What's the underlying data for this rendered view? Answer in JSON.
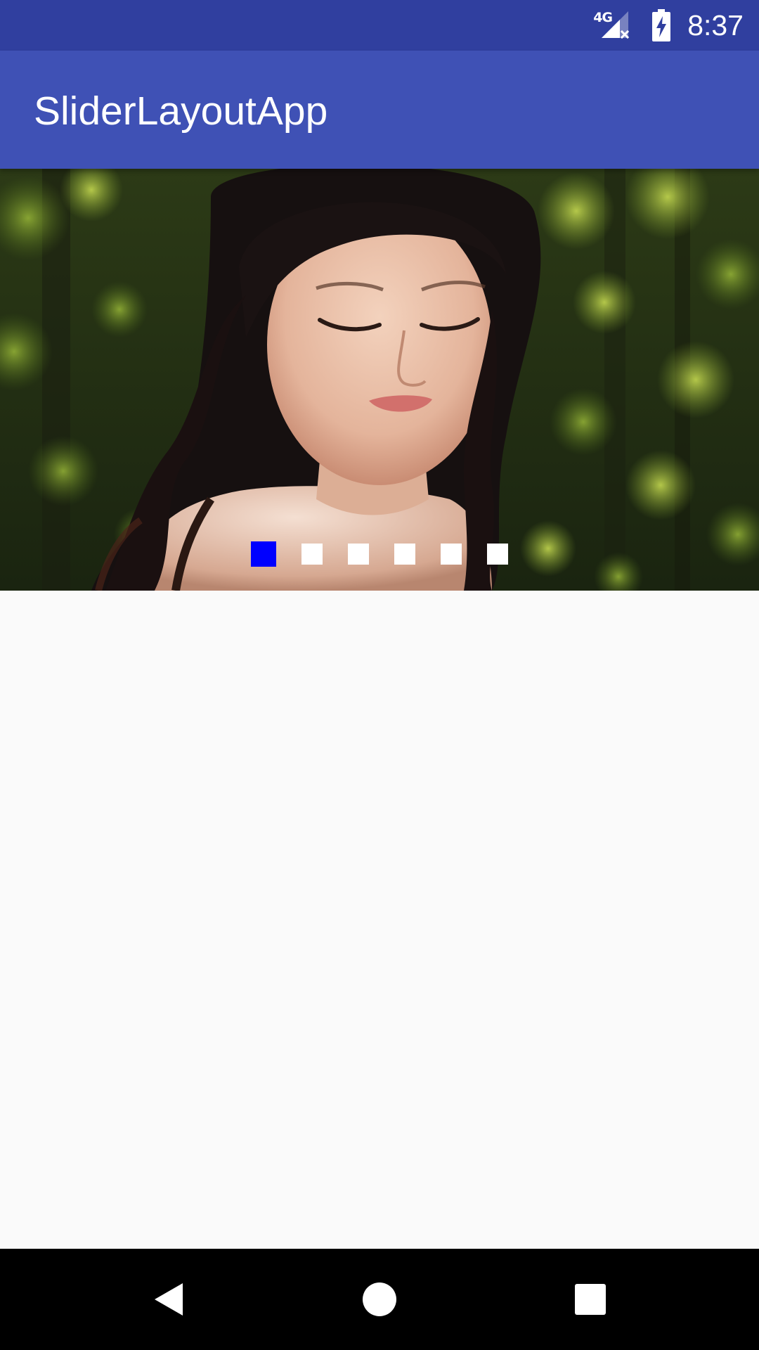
{
  "status_bar": {
    "network_type": "4G",
    "time": "8:37",
    "background_color": "#303f9f",
    "icons": [
      "signal-no-data-icon",
      "battery-charging-icon"
    ]
  },
  "app_bar": {
    "title": "SliderLayoutApp",
    "background_color": "#3f51b5"
  },
  "slider": {
    "slide_count": 6,
    "active_index": 0,
    "active_indicator_color": "#0000ff",
    "inactive_indicator_color": "#ffffff"
  },
  "nav_bar": {
    "buttons": [
      "back-icon",
      "home-icon",
      "recents-icon"
    ],
    "background_color": "#000000"
  }
}
